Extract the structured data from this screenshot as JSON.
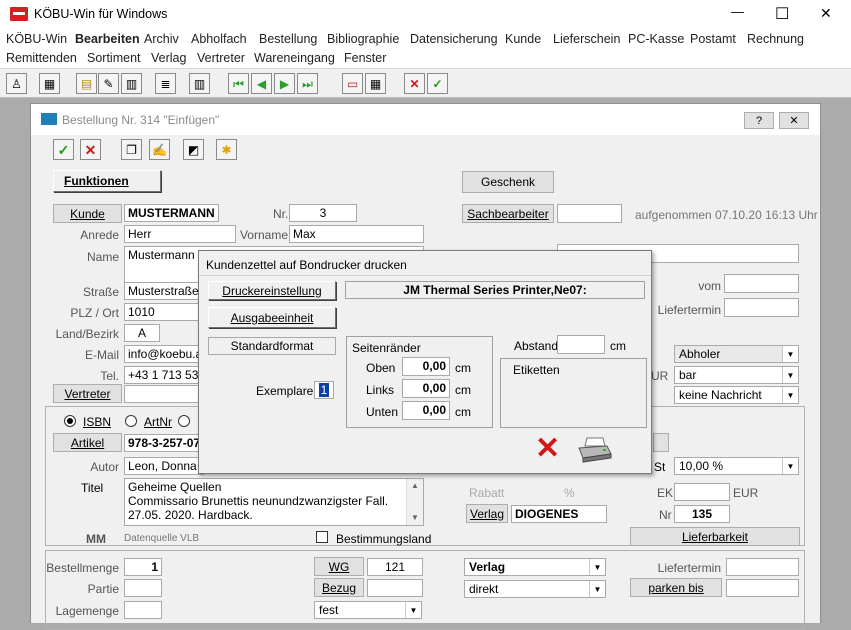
{
  "app": {
    "title": "KÖBU-Win für Windows",
    "controls": {
      "minimize": "—",
      "maximize": "☐",
      "close": "✕"
    }
  },
  "menu": {
    "row1": [
      "KÖBU-Win",
      "Bearbeiten",
      "Archiv",
      "Abholfach",
      "Bestellung",
      "Bibliographie",
      "Datensicherung",
      "Kunde",
      "Lieferschein",
      "PC-Kasse",
      "Postamt",
      "Rechnung"
    ],
    "row2": [
      "Remittenden",
      "Sortiment",
      "Verlag",
      "Vertreter",
      "Wareneingang",
      "Fenster"
    ]
  },
  "child": {
    "title": "Bestellung Nr. 314 \"Einfügen\"",
    "help": "?",
    "close": "✕",
    "ok_glyph": "✓",
    "cancel_glyph": "✕"
  },
  "form": {
    "funktionen": "Funktionen",
    "geschenk": "Geschenk",
    "kunde_btn": "Kunde",
    "kunde_value": "MUSTERMANN",
    "nr_label": "Nr.",
    "nr_value": "3",
    "sachbearbeiter_btn": "Sachbearbeiter",
    "sachbearbeiter_value": "",
    "aufgenommen": "aufgenommen 07.10.20  16:13 Uhr",
    "anrede_label": "Anrede",
    "anrede_value": "Herr",
    "vorname_label": "Vorname",
    "vorname_value": "Max",
    "name_label": "Name",
    "name_value": "Mustermann",
    "vom_label": "vom",
    "liefertermin_label": "Liefertermin",
    "strasse_label": "Straße",
    "strasse_value": "Musterstraße 1",
    "plz_label": "PLZ / Ort",
    "plz_value": "1010",
    "land_label": "Land/Bezirk",
    "land_value": "A",
    "email_label": "E-Mail",
    "email_value": "info@koebu.at",
    "tel_label": "Tel.",
    "tel_value": "+43 1 713 53 4",
    "vertreter_btn": "Vertreter",
    "abholer_value": "Abholer",
    "ur_label": "UR",
    "bar_value": "bar",
    "nachricht_value": "keine Nachricht",
    "isbn_label": "ISBN",
    "artnr_label": "ArtNr",
    "artikel_btn": "Artikel",
    "artikel_value": "978-3-257-07",
    "autor_label": "Autor",
    "autor_value": "Leon, Donna",
    "titel_label": "Titel",
    "titel_value": "Geheime Quellen\nCommissario Brunettis neunundzwanzigster Fall. 27.05. 2020. Hardback.",
    "st_label": "St",
    "mwst_value": "10,00 %",
    "rabatt_label": "Rabatt",
    "prozent_label": "%",
    "ek_label": "EK",
    "eur_label": "EUR",
    "verlag_btn": "Verlag",
    "verlag_value": "DIOGENES",
    "nr2_label": "Nr",
    "nr2_value": "135",
    "mm_label": "MM",
    "datenquelle": "Datenquelle VLB",
    "bestimmungsland_label": "Bestimmungsland",
    "lieferbarkeit_btn": "Lieferbarkeit",
    "bestellmenge_label": "Bestellmenge",
    "bestellmenge_value": "1",
    "wg_btn": "WG",
    "wg_value": "121",
    "verlag_dd": "Verlag",
    "liefertermin2_label": "Liefertermin",
    "partie_label": "Partie",
    "bezug_btn": "Bezug",
    "direkt_value": "direkt",
    "parken_btn": "parken bis",
    "lagemenge_label": "Lagemenge",
    "fest_value": "fest"
  },
  "dialog": {
    "title": "Kundenzettel auf Bondrucker drucken",
    "druckereinstellung": "Druckereinstellung",
    "printer_name": "JM Thermal Series Printer,Ne07:",
    "ausgabeeinheit": "Ausgabeeinheit",
    "standardformat": "Standardformat",
    "seitenraender": "Seitenränder",
    "oben_label": "Oben",
    "oben_value": "0,00",
    "links_label": "Links",
    "links_value": "0,00",
    "unten_label": "Unten",
    "unten_value": "0,00",
    "cm": "cm",
    "abstand_label": "Abstand",
    "abstand_value": "",
    "etiketten_label": "Etiketten",
    "exemplare_label": "Exemplare",
    "exemplare_value": "1"
  },
  "colors": {
    "ok_green": "#1f9a1f",
    "cancel_red": "#d01818",
    "bg_mdi": "#ababab"
  }
}
